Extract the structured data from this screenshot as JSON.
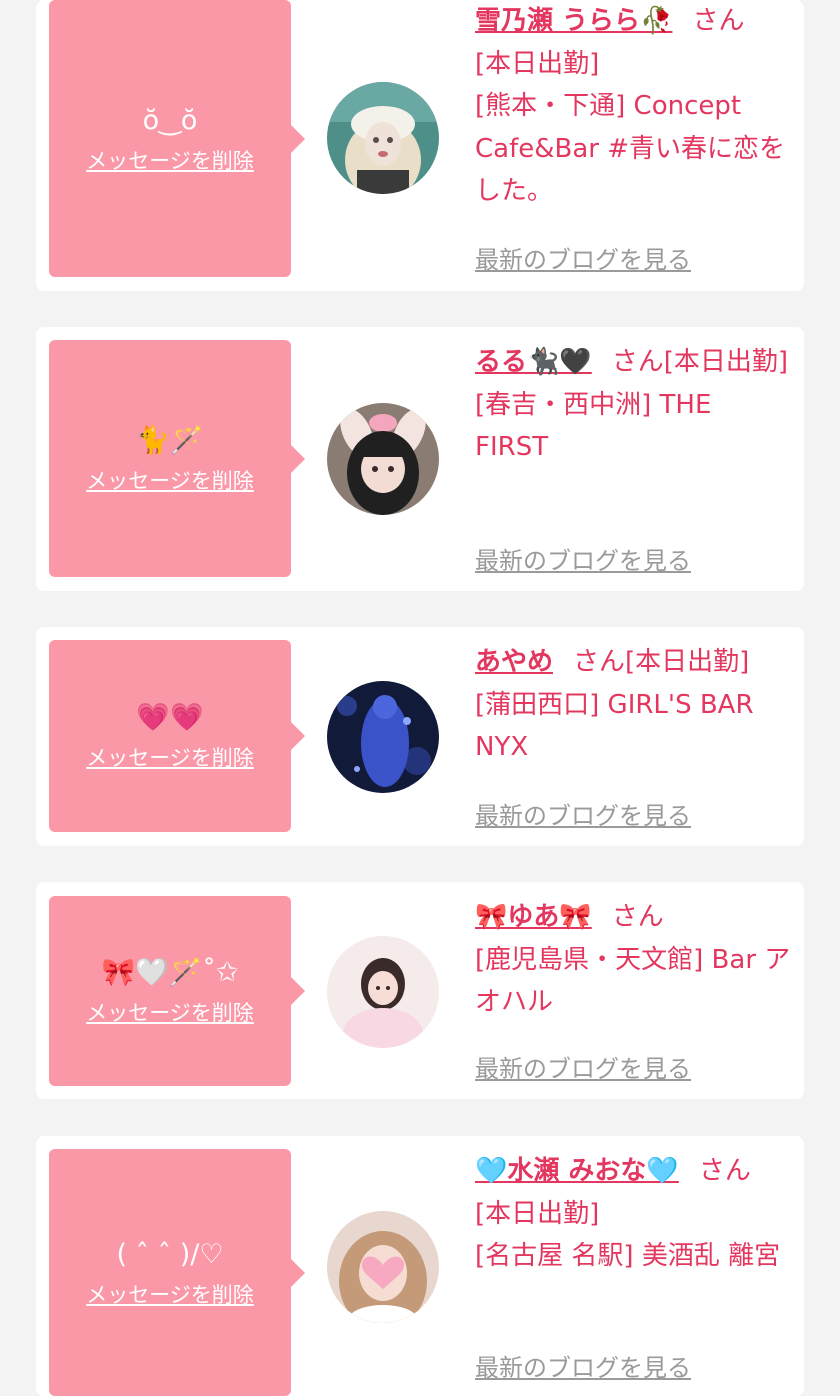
{
  "delete_label": "メッセージを削除",
  "blog_label": "最新のブログを見る",
  "cards": [
    {
      "message": "ŏ‿ŏ",
      "name": "雪乃瀬 うらら🥀",
      "san": "さん",
      "line1": "[本日出勤]",
      "store": "[熊本・下通] Concept Cafe&Bar #青い春に恋をした。"
    },
    {
      "message": "🐈🪄",
      "name": "るる🐈‍⬛🖤",
      "san": "さん[本日出勤]",
      "line1": "",
      "store": "[春吉・西中洲] THE FIRST"
    },
    {
      "message": "💗💗",
      "name": "あやめ",
      "san": "さん[本日出勤]",
      "line1": "",
      "store": "[蒲田西口] GIRL'S BAR NYX"
    },
    {
      "message": "🎀🤍🪄˚✩",
      "name": "🎀ゆあ🎀",
      "san": "さん",
      "line1": "",
      "store": "[鹿児島県・天文館] Bar アオハル"
    },
    {
      "message": "( ˆ ˆ )/♡",
      "name": "🩵水瀬 みおな🩵",
      "san": "さん",
      "line1": "[本日出勤]",
      "store": "[名古屋 名駅] 美酒乱 離宮"
    }
  ],
  "colors": {
    "page_background": "#f3f3f3",
    "bubble": "#fb98a8",
    "accent_text": "#e3375f",
    "muted_link": "#9a9a9a"
  }
}
